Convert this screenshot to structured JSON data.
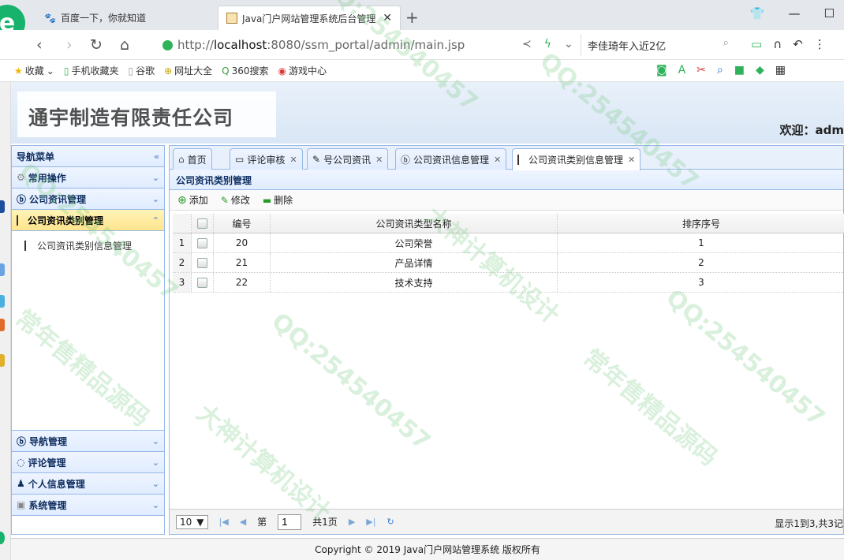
{
  "browser": {
    "tabs": [
      {
        "title": "百度一下，你就知道"
      },
      {
        "title": "Java门户网站管理系统后台管理"
      }
    ],
    "address": {
      "prefix": "http://",
      "host": "localhost",
      "rest": ":8080/ssm_portal/admin/main.jsp"
    },
    "search_text": "李佳琦年入近2亿",
    "bookmarks": [
      "收藏",
      "手机收藏夹",
      "谷歌",
      "网址大全",
      "360搜索",
      "游戏中心"
    ]
  },
  "app": {
    "company": "通宇制造有限责任公司",
    "welcome_label": "欢迎：",
    "welcome_user": "adm"
  },
  "west": {
    "title": "导航菜单",
    "groups_top": [
      {
        "label": "常用操作"
      },
      {
        "label": "公司资讯管理"
      },
      {
        "label": "公司资讯类别管理"
      }
    ],
    "active_item": "公司资讯类别信息管理",
    "groups_bottom": [
      {
        "label": "导航管理"
      },
      {
        "label": "评论管理"
      },
      {
        "label": "个人信息管理"
      },
      {
        "label": "系统管理"
      }
    ]
  },
  "tabs": [
    {
      "label": "首页",
      "closable": false
    },
    {
      "label": "评论审核",
      "closable": true
    },
    {
      "label": "号公司资讯",
      "closable": true
    },
    {
      "label": "公司资讯信息管理",
      "closable": true
    },
    {
      "label": "公司资讯类别信息管理",
      "closable": true
    }
  ],
  "panel": {
    "title": "公司资讯类别管理",
    "toolbar": {
      "add": "添加",
      "edit": "修改",
      "delete": "删除"
    },
    "columns": {
      "id": "编号",
      "name": "公司资讯类型名称",
      "order": "排序序号"
    },
    "rows": [
      {
        "rn": "1",
        "id": "20",
        "name": "公司荣誉",
        "order": "1"
      },
      {
        "rn": "2",
        "id": "21",
        "name": "产品详情",
        "order": "2"
      },
      {
        "rn": "3",
        "id": "22",
        "name": "技术支持",
        "order": "3"
      }
    ],
    "pager": {
      "page_size": "10",
      "page_label": "第",
      "page": "1",
      "total_pages": "共1页",
      "info": "显示1到3,共3记"
    }
  },
  "footer": "Copyright © 2019 Java门户网站管理系统 版权所有",
  "watermarks": [
    "QQ:254540457",
    "大神计算机设计",
    "常年售精品源码"
  ]
}
